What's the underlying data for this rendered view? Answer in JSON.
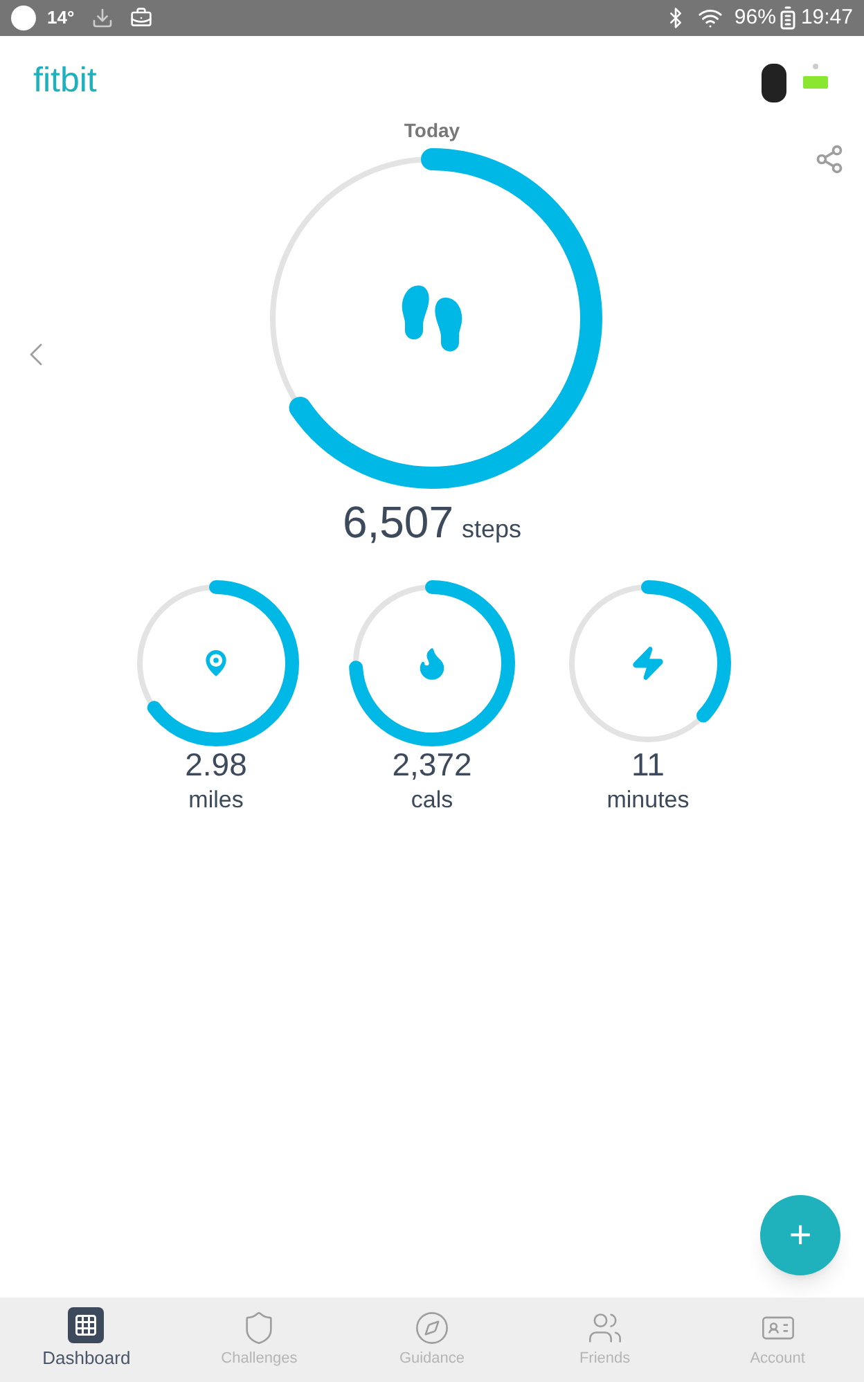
{
  "status_bar": {
    "temperature": "14°",
    "battery": "96%",
    "time": "19:47"
  },
  "header": {
    "logo": "fitbit"
  },
  "today": {
    "label": "Today",
    "level": 0.655,
    "value": "6,507",
    "unit": "steps"
  },
  "stats": [
    {
      "kind": "distance",
      "value": "2.98",
      "unit": "miles",
      "level": 0.65
    },
    {
      "kind": "calories",
      "value": "2,372",
      "unit": "cals",
      "level": 0.74
    },
    {
      "kind": "active",
      "value": "11",
      "unit": "minutes",
      "level": 0.37
    }
  ],
  "fab": {
    "label": "+"
  },
  "nav": [
    {
      "kind": "dashboard",
      "label": "Dashboard",
      "selected": true
    },
    {
      "kind": "challenges",
      "label": "Challenges",
      "selected": false
    },
    {
      "kind": "guidance",
      "label": "Guidance",
      "selected": false
    },
    {
      "kind": "friends",
      "label": "Friends",
      "selected": false
    },
    {
      "kind": "account",
      "label": "Account",
      "selected": false
    }
  ]
}
